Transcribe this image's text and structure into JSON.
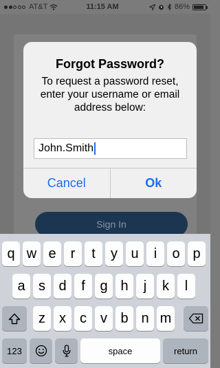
{
  "status_bar": {
    "signal_filled": 2,
    "signal_total": 5,
    "carrier": "AT&T",
    "time": "11:15 AM",
    "battery_percent": "86%",
    "battery_level": 0.86
  },
  "background": {
    "sign_in_label": "Sign In"
  },
  "alert": {
    "title": "Forgot Password?",
    "message": "To request a password reset, enter your username or email address below:",
    "input_value": "John.Smith",
    "cancel_label": "Cancel",
    "ok_label": "Ok"
  },
  "keyboard": {
    "row1": [
      "q",
      "w",
      "e",
      "r",
      "t",
      "y",
      "u",
      "i",
      "o",
      "p"
    ],
    "row2": [
      "a",
      "s",
      "d",
      "f",
      "g",
      "h",
      "j",
      "k",
      "l"
    ],
    "row3": [
      "z",
      "x",
      "c",
      "v",
      "b",
      "n",
      "m"
    ],
    "numbers_label": "123",
    "space_label": "space",
    "return_label": "return",
    "icons": {
      "shift": "shift-icon",
      "delete": "delete-icon",
      "emoji": "emoji-icon",
      "mic": "microphone-icon"
    }
  }
}
